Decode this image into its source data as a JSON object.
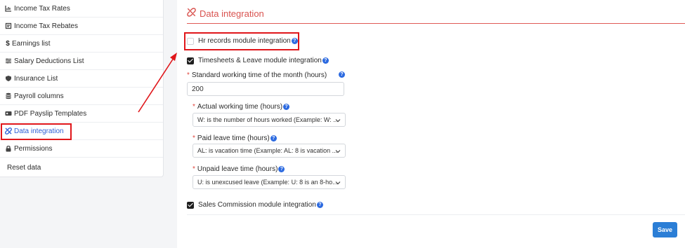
{
  "sidebar": {
    "items": [
      {
        "label": "Income Tax Rates",
        "icon": "bar-chart-icon"
      },
      {
        "label": "Income Tax Rebates",
        "icon": "receipt-icon"
      },
      {
        "label": "Earnings list",
        "icon": "dollar-icon"
      },
      {
        "label": "Salary Deductions List",
        "icon": "list-icon"
      },
      {
        "label": "Insurance List",
        "icon": "shield-icon"
      },
      {
        "label": "Payroll columns",
        "icon": "database-icon"
      },
      {
        "label": "PDF Payslip Templates",
        "icon": "id-card-icon"
      },
      {
        "label": "Data integration",
        "icon": "link-broken-icon",
        "active": true
      },
      {
        "label": "Permissions",
        "icon": "lock-icon"
      },
      {
        "label": "Reset data",
        "icon": ""
      }
    ]
  },
  "main": {
    "title": "Data integration",
    "hr_module": {
      "label": "Hr records module integration",
      "checked": false
    },
    "timesheets_module": {
      "label": "Timesheets & Leave module integration",
      "checked": true
    },
    "standard_time": {
      "label": "Standard working time of the month (hours)",
      "value": "200"
    },
    "actual_time": {
      "label": "Actual working time (hours)",
      "value": "W: is the number of hours worked (Example: W: ..."
    },
    "paid_leave": {
      "label": "Paid leave time (hours)",
      "value": "AL: is vacation time (Example: AL: 8 is vacation ..."
    },
    "unpaid_leave": {
      "label": "Unpaid leave time (hours)",
      "value": "U: is unexcused leave (Example: U: 8 is an 8-ho..."
    },
    "sales_module": {
      "label": "Sales Commission module integration",
      "checked": true
    },
    "save_label": "Save",
    "help_glyph": "?",
    "required_glyph": "*"
  },
  "colors": {
    "accent_red": "#d9534f",
    "link_blue": "#2c5fd6",
    "save_blue": "#2b7ed6",
    "annotation_red": "#e0161a"
  }
}
